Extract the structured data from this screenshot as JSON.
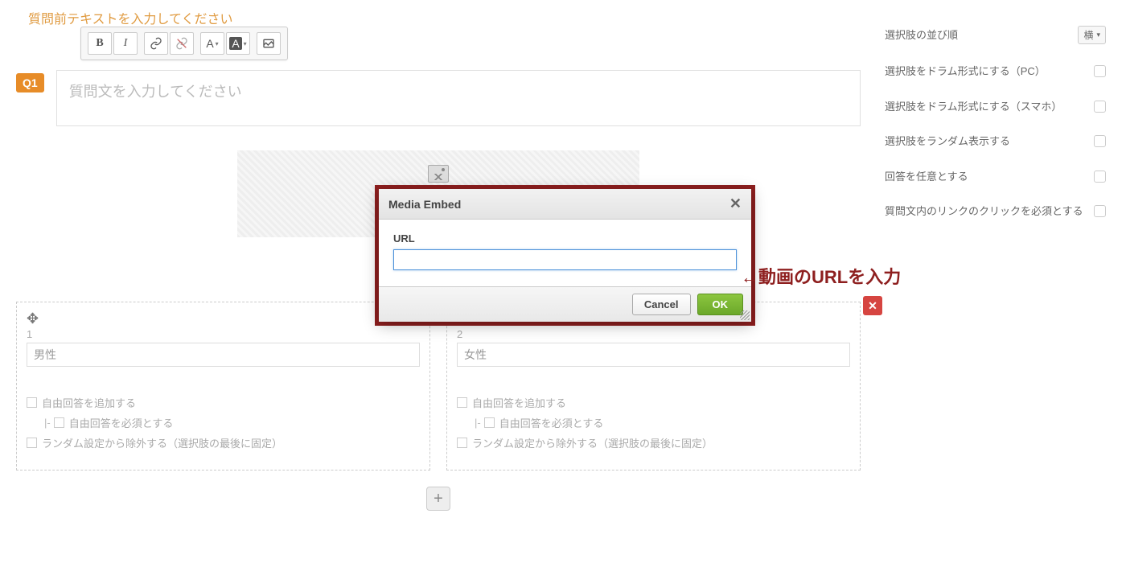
{
  "preface_placeholder": "質問前テキストを入力してください",
  "question_badge": "Q1",
  "question_placeholder": "質問文を入力してください",
  "toolbar": {
    "bold": "B",
    "italic": "I",
    "font_letter": "A",
    "bg_letter": "A"
  },
  "dialog": {
    "title": "Media Embed",
    "url_label": "URL",
    "url_value": "",
    "cancel": "Cancel",
    "ok": "OK",
    "close_glyph": "✕"
  },
  "annotation": "←動画のURLを入力",
  "choices": [
    {
      "num": "1",
      "value": "男性"
    },
    {
      "num": "2",
      "value": "女性"
    }
  ],
  "choice_opts": {
    "free_add": "自由回答を追加する",
    "indent_prefix": " |- ",
    "free_req": "自由回答を必須とする",
    "exclude_random": "ランダム設定から除外する（選択肢の最後に固定）"
  },
  "delete_glyph": "✕",
  "drag_glyph": "✥",
  "add_glyph": "+",
  "sidebar": {
    "order_label": "選択肢の並び順",
    "order_value": "横",
    "drum_pc": "選択肢をドラム形式にする（PC）",
    "drum_sp": "選択肢をドラム形式にする（スマホ）",
    "random": "選択肢をランダム表示する",
    "optional": "回答を任意とする",
    "link_click": "質問文内のリンクのクリックを必須とする"
  }
}
